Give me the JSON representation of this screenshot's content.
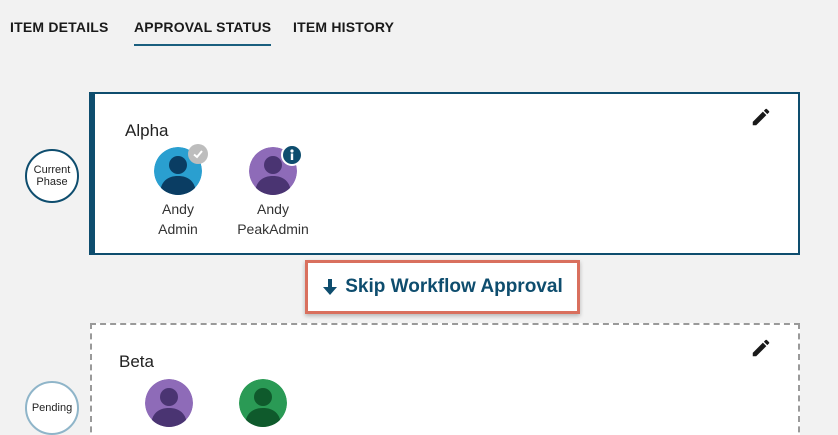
{
  "tabs": [
    {
      "label": "ITEM DETAILS",
      "active": false
    },
    {
      "label": "APPROVAL STATUS",
      "active": true
    },
    {
      "label": "ITEM HISTORY",
      "active": false
    }
  ],
  "phases": {
    "current_label_line1": "Current",
    "current_label_line2": "Phase",
    "pending_label": "Pending"
  },
  "alpha": {
    "title": "Alpha",
    "approvers": [
      {
        "first": "Andy",
        "last": "Admin",
        "avatar_color": "#2a9fd0",
        "badge": "check-icon"
      },
      {
        "first": "Andy",
        "last": "PeakAdmin",
        "avatar_color": "#8e6bb8",
        "badge": "info-icon"
      }
    ]
  },
  "skip": {
    "label": "Skip Workflow Approval"
  },
  "beta": {
    "title": "Beta",
    "approvers": [
      {
        "avatar_color": "#8e6bb8"
      },
      {
        "avatar_color": "#2a9a55"
      }
    ]
  },
  "colors": {
    "accent": "#0e4d6e",
    "highlight_border": "#d9705e",
    "page_bg": "#f2f2f2"
  }
}
